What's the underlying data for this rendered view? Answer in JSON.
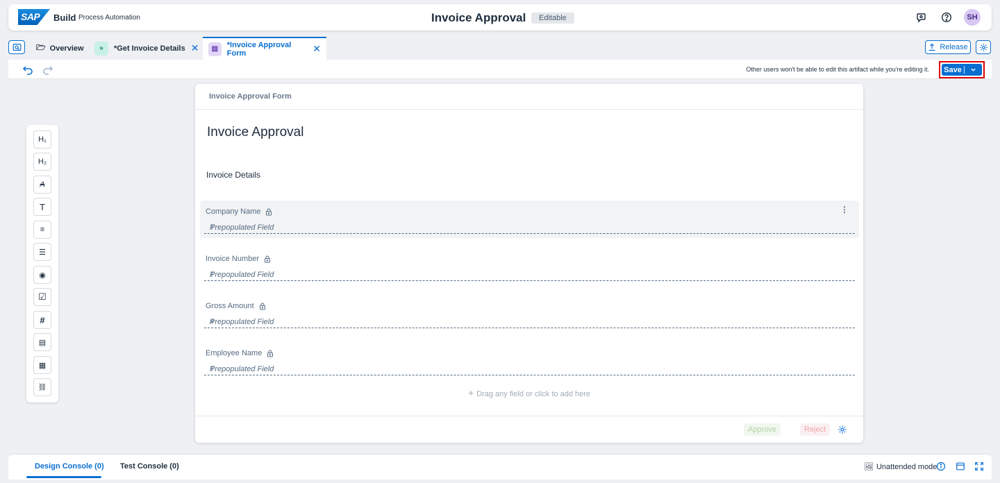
{
  "shell": {
    "logo_text": "SAP",
    "brand": "Build",
    "brand_sub": "Process Automation",
    "title": "Invoice Approval",
    "status_badge": "Editable",
    "avatar_initials": "SH"
  },
  "tabs": [
    {
      "label": "Overview",
      "icon": "folder-icon"
    },
    {
      "label": "*Get Invoice Details",
      "icon": "process-icon"
    },
    {
      "label": "*Invoice Approval Form",
      "icon": "form-icon"
    }
  ],
  "tabbar_actions": {
    "release_label": "Release"
  },
  "toolbar": {
    "lock_message": "Other users won't be able to edit this artifact while you're editing it.",
    "save_label": "Save"
  },
  "palette": {
    "items": [
      {
        "glyph": "H₁",
        "icon": "heading1-icon"
      },
      {
        "glyph": "H₂",
        "icon": "heading2-icon"
      },
      {
        "glyph": "A",
        "icon": "paragraph-icon"
      },
      {
        "glyph": "T",
        "icon": "text-field-icon"
      },
      {
        "glyph": "≡",
        "icon": "text-area-icon"
      },
      {
        "glyph": "☰",
        "icon": "checklist-icon"
      },
      {
        "glyph": "◉",
        "icon": "radio-icon"
      },
      {
        "glyph": "☑",
        "icon": "checkbox-icon"
      },
      {
        "glyph": "#",
        "icon": "number-icon"
      },
      {
        "glyph": "▤",
        "icon": "date-icon"
      },
      {
        "glyph": "▦",
        "icon": "table-icon"
      },
      {
        "glyph": "⛓",
        "icon": "link-icon"
      }
    ]
  },
  "form": {
    "header": "Invoice Approval Form",
    "title": "Invoice Approval",
    "section": "Invoice Details",
    "fields": [
      {
        "label": "Company Name",
        "placeholder": "Prepopulated Field",
        "type_glyph": "T"
      },
      {
        "label": "Invoice Number",
        "placeholder": "Prepopulated Field",
        "type_glyph": "T"
      },
      {
        "label": "Gross Amount",
        "placeholder": "Prepopulated Field",
        "type_glyph": "#"
      },
      {
        "label": "Employee Name",
        "placeholder": "Prepopulated Field",
        "type_glyph": "T"
      }
    ],
    "dropzone": "Drag any field or click to add here",
    "approve_label": "Approve",
    "reject_label": "Reject"
  },
  "console": {
    "design_tab": "Design Console (0)",
    "test_tab": "Test Console (0)",
    "mode_label": "Unattended mode"
  },
  "colors": {
    "accent": "#0a6ed1",
    "highlight": "#e00000"
  }
}
